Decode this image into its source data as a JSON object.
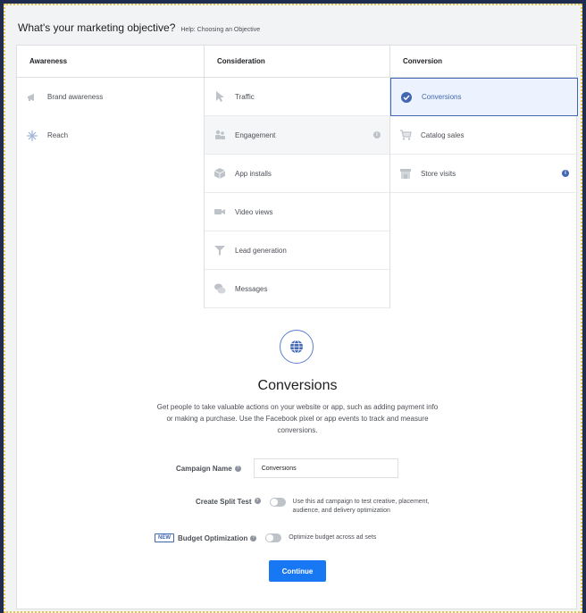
{
  "header": {
    "question": "What's your marketing objective?",
    "help_link": "Help: Choosing an Objective"
  },
  "columns": [
    {
      "title": "Awareness",
      "items": [
        {
          "label": "Brand awareness",
          "icon": "megaphone-icon"
        },
        {
          "label": "Reach",
          "icon": "reach-icon"
        }
      ]
    },
    {
      "title": "Consideration",
      "items": [
        {
          "label": "Traffic",
          "icon": "cursor-icon"
        },
        {
          "label": "Engagement",
          "icon": "people-icon",
          "hovered": true,
          "info": "i"
        },
        {
          "label": "App installs",
          "icon": "box-icon"
        },
        {
          "label": "Video views",
          "icon": "video-camera-icon"
        },
        {
          "label": "Lead generation",
          "icon": "funnel-icon"
        },
        {
          "label": "Messages",
          "icon": "chat-bubbles-icon"
        }
      ]
    },
    {
      "title": "Conversion",
      "items": [
        {
          "label": "Conversions",
          "icon": "check-circle-icon",
          "selected": true
        },
        {
          "label": "Catalog sales",
          "icon": "cart-icon"
        },
        {
          "label": "Store visits",
          "icon": "store-icon",
          "info": "i"
        }
      ]
    }
  ],
  "detail": {
    "icon": "globe-icon",
    "title": "Conversions",
    "description": "Get people to take valuable actions on your website or app, such as adding payment info or making a purchase. Use the Facebook pixel or app events to track and measure conversions.",
    "campaign_name_label": "Campaign Name",
    "campaign_name_value": "Conversions",
    "split_test_label": "Create Split Test",
    "split_test_text": "Use this ad campaign to test creative, placement, audience, and delivery optimization",
    "split_test_on": false,
    "new_badge": "NEW",
    "budget_label": "Budget Optimization",
    "budget_text": "Optimize budget across ad sets",
    "budget_on": false,
    "continue_label": "Continue"
  },
  "colors": {
    "accent": "#4267b2",
    "button": "#1877f2",
    "selected_bg": "#ecf3ff"
  }
}
